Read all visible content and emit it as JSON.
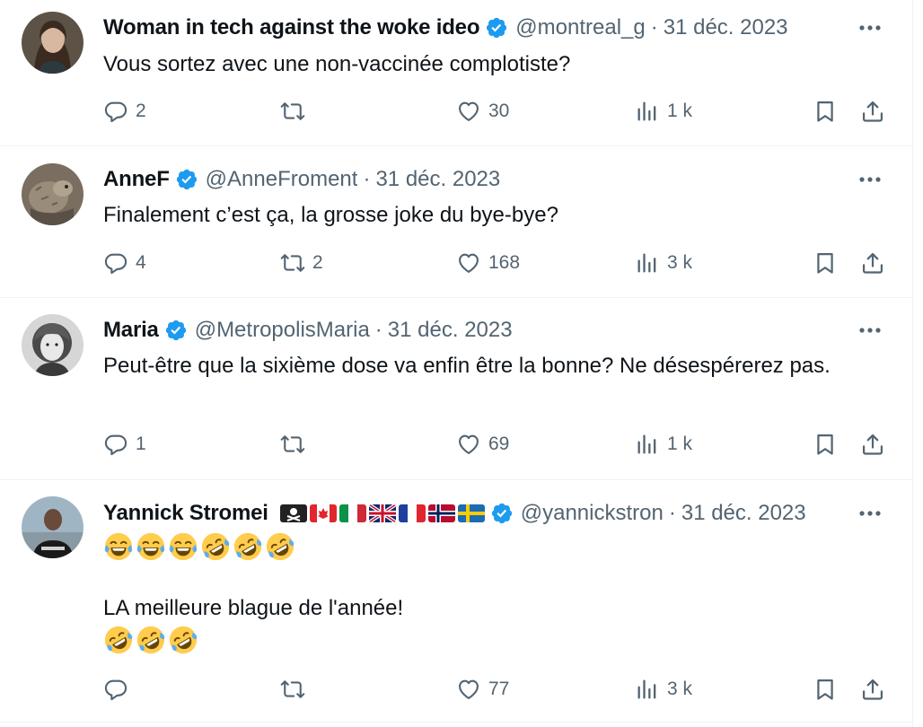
{
  "colors": {
    "text": "#0f1419",
    "muted": "#536471",
    "verified": "#1d9bf0",
    "divider": "#eff3f4"
  },
  "tweets": [
    {
      "name": "Woman in tech against the woke ideo",
      "handle": "@montreal_g",
      "date": "31 déc. 2023",
      "text": "Vous sortez avec une non-vaccinée complotiste?",
      "replies": "2",
      "retweets": "",
      "likes": "30",
      "views": "1 k",
      "avatar": "woman-avatar"
    },
    {
      "name": "AnneF",
      "handle": "@AnneFroment",
      "date": "31 déc. 2023",
      "text": "Finalement c’est ça, la grosse joke du bye-bye?",
      "replies": "4",
      "retweets": "2",
      "likes": "168",
      "views": "3 k",
      "avatar": "animal-avatar"
    },
    {
      "name": "Maria",
      "handle": "@MetropolisMaria",
      "date": "31 déc. 2023",
      "text": "Peut-être que la sixième dose va enfin être la bonne? Ne désespérerez pas.",
      "replies": "1",
      "retweets": "",
      "likes": "69",
      "views": "1 k",
      "avatar": "vintage-portrait-avatar"
    },
    {
      "name": "Yannick Stromei",
      "handle": "@yannickstron",
      "date": "31 déc. 2023",
      "flags": [
        "pirate-flag",
        "canada-flag",
        "italy-flag",
        "uk-flag",
        "france-flag",
        "norway-flag",
        "sweden-flag"
      ],
      "emoji_line_1": [
        "joy",
        "joy",
        "joy",
        "rofl",
        "rofl",
        "rofl"
      ],
      "text": "LA meilleure blague de l'année!",
      "emoji_line_2": [
        "rofl",
        "rofl",
        "rofl"
      ],
      "replies": "",
      "retweets": "",
      "likes": "77",
      "views": "3 k",
      "avatar": "man-avatar"
    }
  ]
}
